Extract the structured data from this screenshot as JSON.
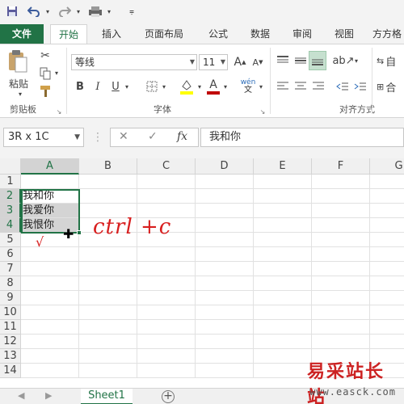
{
  "colors": {
    "accent": "#217346",
    "annotation": "#d81e1e",
    "selection_shade": "#d4d4d4"
  },
  "qat": {
    "icons": [
      "save-icon",
      "undo-icon",
      "redo-icon",
      "print-preview-icon",
      "customize-icon"
    ]
  },
  "tabs": [
    "文件",
    "开始",
    "插入",
    "页面布局",
    "公式",
    "数据",
    "审阅",
    "视图",
    "方方格"
  ],
  "active_tab": "开始",
  "ribbon": {
    "clipboard": {
      "paste_label": "粘贴",
      "group_label": "剪贴板"
    },
    "font": {
      "font_name": "等线",
      "font_size": "11",
      "grow_label": "A",
      "shrink_label": "A",
      "bold": "B",
      "italic": "I",
      "underline": "U",
      "font_color_letter": "A",
      "phonetic": "wén",
      "group_label": "字体"
    },
    "alignment": {
      "group_label": "对齐方式",
      "wrap_label": "自",
      "merge_label": "合"
    }
  },
  "formula_bar": {
    "name_box": "3R x 1C",
    "cancel": "✕",
    "enter": "✓",
    "fx": "fx",
    "value": "我和你"
  },
  "grid": {
    "columns": [
      "A",
      "B",
      "C",
      "D",
      "E",
      "F",
      "G"
    ],
    "rows": [
      "1",
      "2",
      "3",
      "4",
      "5",
      "6",
      "7",
      "8",
      "9",
      "10",
      "11",
      "12",
      "13",
      "14"
    ],
    "cells": {
      "A2": "我和你",
      "A3": "我爱你",
      "A4": "我恨你"
    },
    "selected_range": "A2:A4"
  },
  "annotation": {
    "text": "ctrl +c",
    "check": "√"
  },
  "sheets": [
    "Sheet1"
  ],
  "add_sheet": "+",
  "watermark": {
    "main": "易采站长站",
    "sub": "www.easck.com"
  }
}
